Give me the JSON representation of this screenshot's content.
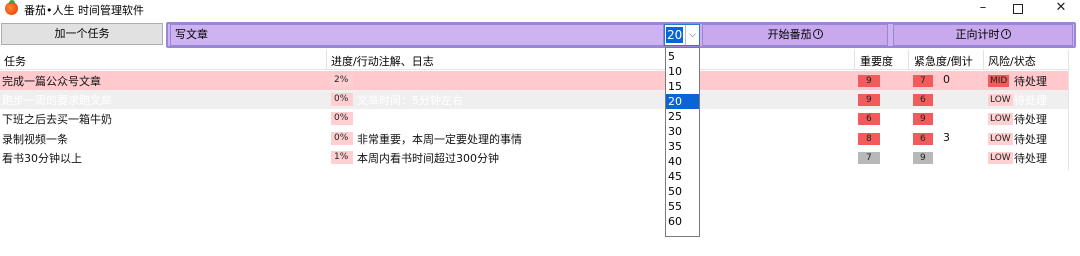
{
  "window": {
    "title": "番茄•人生 时间管理软件",
    "minimize": "–",
    "close": "✕"
  },
  "toolbar": {
    "add_label": "加一个任务",
    "task_input_value": "写文章",
    "minutes_value": "20",
    "start_label": "开始番茄",
    "timer_label": "正向计时"
  },
  "columns": {
    "task": "任务",
    "progress": "进度/行动注解、日志",
    "importance": "重要度",
    "urgency": "紧急度/倒计",
    "risk": "风险/状态"
  },
  "rows": [
    {
      "task": "完成一篇公众号文章",
      "progress": "2%",
      "note": "",
      "importance": "9",
      "urgency": "7",
      "count": "0",
      "risk": "MID",
      "status": "待处理",
      "importance_color": "#f25b5b",
      "urgency_color": "#f25b5b"
    },
    {
      "task": "跑步一周的要求跑文章",
      "progress": "0%",
      "note": "文章时间：5分钟左右",
      "importance": "9",
      "urgency": "6",
      "count": "",
      "risk": "LOW",
      "status": "待处理",
      "importance_color": "#f25b5b",
      "urgency_color": "#f25b5b"
    },
    {
      "task": "下班之后去买一箱牛奶",
      "progress": "0%",
      "note": "",
      "importance": "6",
      "urgency": "9",
      "count": "",
      "risk": "LOW",
      "status": "待处理",
      "importance_color": "#f25b5b",
      "urgency_color": "#f25b5b"
    },
    {
      "task": "录制视频一条",
      "progress": "0%",
      "note": "非常重要，本周一定要处理的事情",
      "importance": "8",
      "urgency": "6",
      "count": "3",
      "risk": "LOW",
      "status": "待处理",
      "importance_color": "#f25b5b",
      "urgency_color": "#f25b5b"
    },
    {
      "task": "看书30分钟以上",
      "progress": "1%",
      "note": "本周内看书时间超过300分钟",
      "importance": "7",
      "urgency": "9",
      "count": "",
      "risk": "LOW",
      "status": "待处理",
      "importance_color": "#b8b8b8",
      "urgency_color": "#b8b8b8"
    }
  ],
  "dropdown": {
    "options": [
      "5",
      "10",
      "15",
      "20",
      "25",
      "30",
      "35",
      "40",
      "45",
      "50",
      "55",
      "60"
    ],
    "selected": "20"
  },
  "colors": {
    "accent_purple": "#cdb3f0",
    "highlight_row": "#ffc9cd",
    "selection_blue": "#0a64d6",
    "risk_mid": "#f25b5b",
    "risk_low": "#ffcfd2"
  }
}
